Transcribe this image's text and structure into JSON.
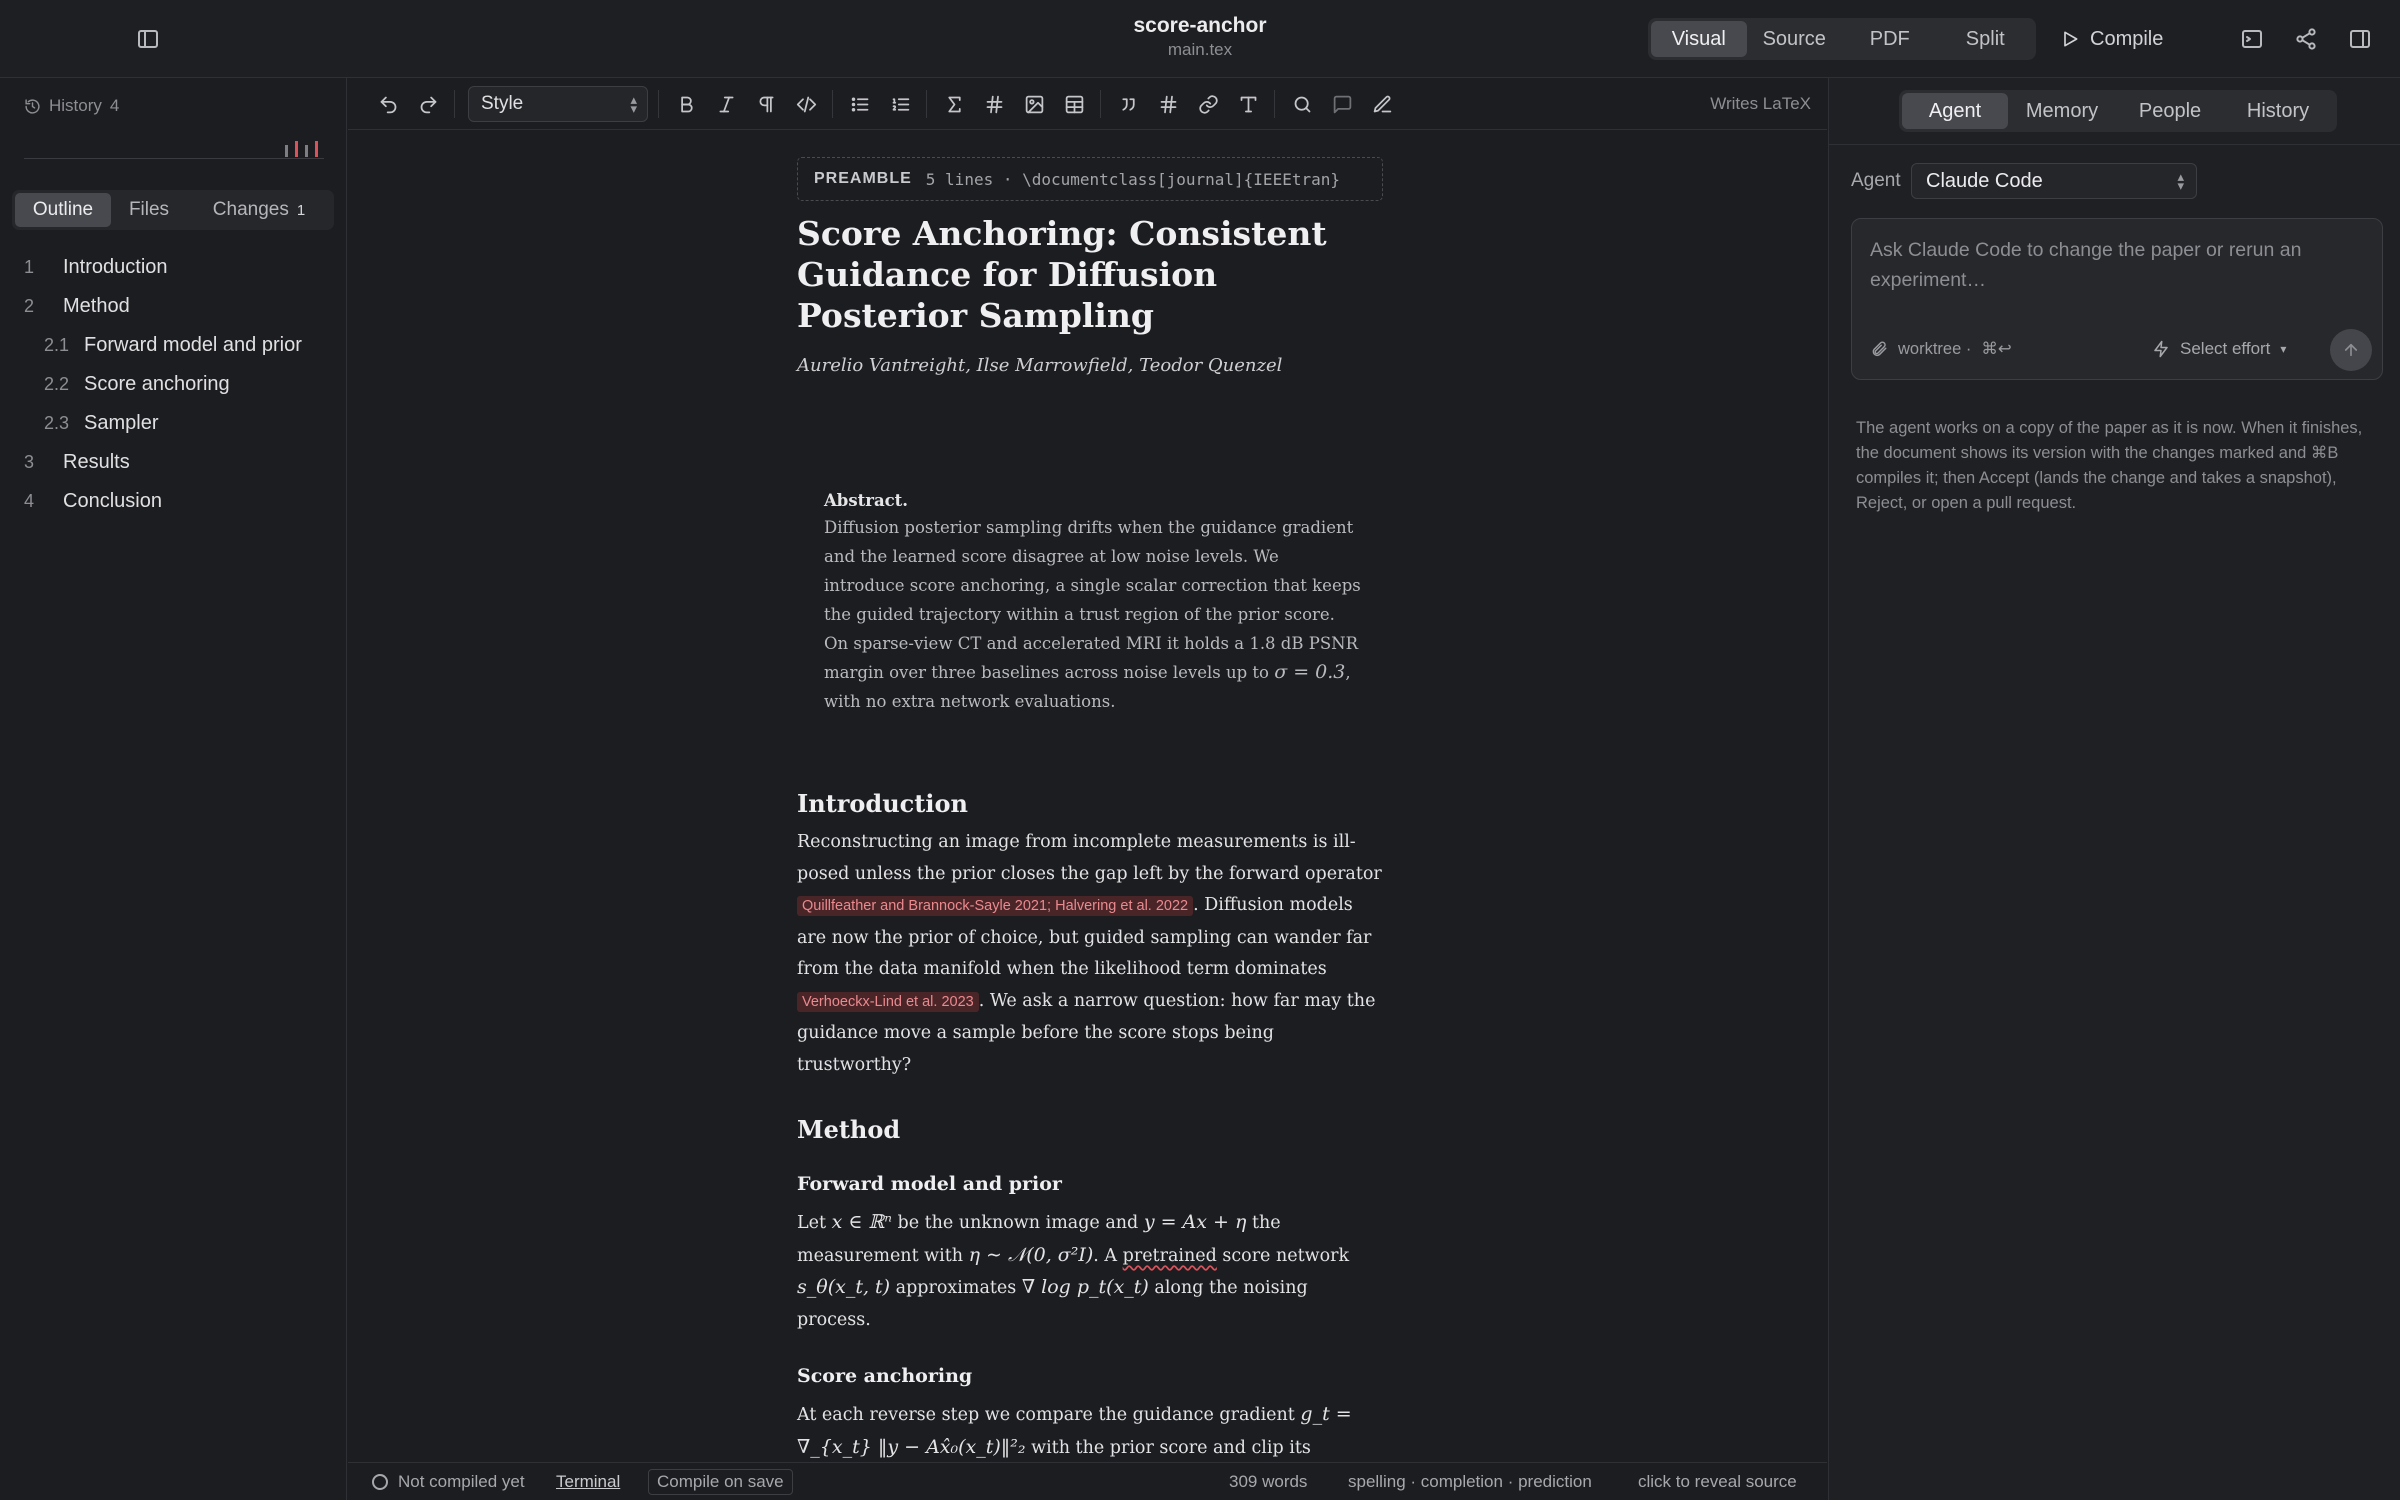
{
  "window": {
    "project_name": "score-anchor",
    "file_name": "main.tex",
    "view_modes": [
      "Visual",
      "Source",
      "PDF",
      "Split"
    ],
    "active_view": "Visual",
    "compile_label": "Compile"
  },
  "left_sidebar": {
    "history_label": "History",
    "history_count": "4",
    "tabs": {
      "outline": "Outline",
      "files": "Files",
      "changes": "Changes",
      "changes_count": "1"
    },
    "outline": [
      {
        "num": "1",
        "label": "Introduction"
      },
      {
        "num": "2",
        "label": "Method"
      },
      {
        "num": "2.1",
        "label": "Forward model and prior"
      },
      {
        "num": "2.2",
        "label": "Score anchoring"
      },
      {
        "num": "2.3",
        "label": "Sampler"
      },
      {
        "num": "3",
        "label": "Results"
      },
      {
        "num": "4",
        "label": "Conclusion"
      }
    ]
  },
  "toolbar": {
    "style_value": "Style",
    "writes_label": "Writes LaTeX",
    "icons": [
      "undo-icon",
      "redo-icon",
      "bold-icon",
      "italic-icon",
      "paragraph-icon",
      "code-icon",
      "bullet-list-icon",
      "numbered-list-icon",
      "sigma-icon",
      "hash-icon",
      "image-icon",
      "table-icon",
      "quote-icon",
      "hash-ref-icon",
      "link-icon",
      "text-icon",
      "search-icon",
      "comment-icon",
      "pen-icon"
    ]
  },
  "document": {
    "preamble_tag": "PREAMBLE",
    "preamble_info": "5 lines · \\documentclass[journal]{IEEEtran}",
    "title": "Score Anchoring: Consistent Guidance for Diffusion Posterior Sampling",
    "authors": "Aurelio Vantreight, Ilse Marrowfield, Teodor Quenzel",
    "abstract_head": "Abstract.",
    "abstract_text_1": "Diffusion posterior sampling drifts when the guidance gradient and the learned score disagree at low noise levels. We introduce score anchoring, a single scalar correction that keeps the guided trajectory within a trust region of the prior score. On sparse-view CT and accelerated MRI it holds a 1.8 dB PSNR margin over three baselines across noise levels up to ",
    "abstract_math": "σ = 0.3",
    "abstract_text_2": ", with no extra network evaluations.",
    "intro_heading": "Introduction",
    "intro_text_1": "Reconstructing an image from incomplete measurements is ill-posed unless the prior closes the gap left by the forward operator ",
    "intro_cite_1": "Quillfeather and Brannock-Sayle 2021; Halvering et al. 2022",
    "intro_text_2": ". Diffusion models are now the prior of choice, but guided sampling can wander far from the data manifold when the likelihood term dominates ",
    "intro_cite_2": "Verhoeckx-Lind et al. 2023",
    "intro_text_3": ". We ask a narrow question: how far may the guidance move a sample before the score stops being trustworthy?",
    "method_heading": "Method",
    "fwd_heading": "Forward model and prior",
    "fwd_t1": "Let ",
    "fwd_m1": "x ∈ ℝⁿ",
    "fwd_t2": " be the unknown image and ",
    "fwd_m2": "y = Ax + η",
    "fwd_t3": " the measurement with ",
    "fwd_m3": "η ∼ 𝒩(0, σ²I)",
    "fwd_t4": ". A ",
    "fwd_spell": "pretrained",
    "fwd_t5": " score network ",
    "fwd_m4": "s_θ(x_t, t)",
    "fwd_t6": " approximates ",
    "fwd_m5": "∇ log p_t(x_t)",
    "fwd_t7": " along the noising process.",
    "anchor_heading": "Score anchoring",
    "anchor_t1": "At each reverse step we compare the guidance gradient ",
    "anchor_m1": "g_t =",
    "anchor_m2": "∇_{x_t} ‖y − Ax̂₀(x_t)‖²₂",
    "anchor_t2": " with the prior score and clip its contribution"
  },
  "statusbar": {
    "compile_status": "Not compiled yet",
    "terminal_label": "Terminal",
    "compile_on_save": "Compile on save",
    "word_count": "309 words",
    "features": "spelling · completion · prediction",
    "hint": "click to reveal source"
  },
  "right_panel": {
    "tabs": [
      "Agent",
      "Memory",
      "People",
      "History"
    ],
    "active_tab": "Agent",
    "agent_label": "Agent",
    "agent_value": "Claude Code",
    "prompt_placeholder": "Ask Claude Code to change the paper or rerun an experiment…",
    "worktree_label": "worktree ·",
    "shortcut_label": "⌘↩",
    "effort_label": "Select effort",
    "note": "The agent works on a copy of the paper as it is now. When it finishes, the document shows its version with the changes marked and ⌘B compiles it; then Accept (lands the change and takes a snapshot), Reject, or open a pull request."
  }
}
